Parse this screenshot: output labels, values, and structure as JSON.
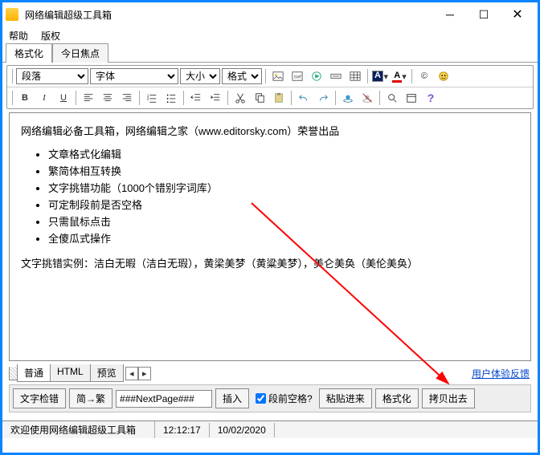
{
  "titlebar": {
    "title": "网络编辑超级工具箱"
  },
  "menubar": {
    "help": "帮助",
    "copyright": "版权"
  },
  "mainTabs": {
    "format": "格式化",
    "today": "今日焦点"
  },
  "toolbar1": {
    "paragraph": "段落",
    "font": "字体",
    "size": "大小",
    "style": "格式"
  },
  "toolbar2": {
    "b": "B",
    "i": "I",
    "u": "U"
  },
  "editor": {
    "intro": "网络编辑必备工具箱，网络编辑之家（www.editorsky.com）荣誉出品",
    "li1": "文章格式化编辑",
    "li2": "繁简体相互转换",
    "li3": "文字挑错功能（1000个错别字词库）",
    "li4": "可定制段前是否空格",
    "li5": "只需鼠标点击",
    "li6": "全傻瓜式操作",
    "example": "文字挑错实例：洁白无暇（洁白无瑕），黄梁美梦（黄粱美梦），美仑美奂（美伦美奂）"
  },
  "viewTabs": {
    "normal": "普通",
    "html": "HTML",
    "preview": "预览"
  },
  "feedback": "用户体验反馈",
  "actions": {
    "spellcheck": "文字检错",
    "simp2trad": "简→繁",
    "nextpage": "###NextPage###",
    "insert": "插入",
    "space_before": "段前空格?",
    "paste_in": "粘贴进来",
    "format": "格式化",
    "copy_out": "拷贝出去"
  },
  "status": {
    "welcome": "欢迎使用网络编辑超级工具箱",
    "time": "12:12:17",
    "date": "10/02/2020"
  }
}
